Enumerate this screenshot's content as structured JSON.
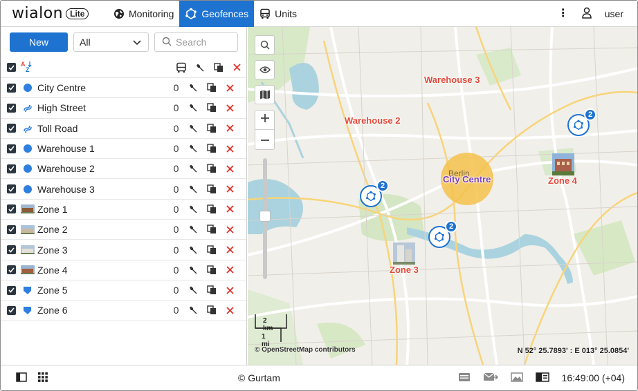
{
  "app": {
    "logo_text": "wialon",
    "logo_badge": "Lite"
  },
  "nav": {
    "tabs": [
      {
        "label": "Monitoring",
        "icon": "globe-icon",
        "active": false
      },
      {
        "label": "Geofences",
        "icon": "geofence-icon",
        "active": true
      },
      {
        "label": "Units",
        "icon": "bus-icon",
        "active": false
      }
    ],
    "user_label": "user"
  },
  "panel": {
    "new_button": "New",
    "filter_select": "All",
    "search_placeholder": "Search",
    "geofences": [
      {
        "name": "City Centre",
        "type": "circle",
        "count": "0"
      },
      {
        "name": "High Street",
        "type": "line",
        "count": "0"
      },
      {
        "name": "Toll Road",
        "type": "line",
        "count": "0"
      },
      {
        "name": "Warehouse 1",
        "type": "circle",
        "count": "0"
      },
      {
        "name": "Warehouse 2",
        "type": "circle",
        "count": "0"
      },
      {
        "name": "Warehouse 3",
        "type": "circle",
        "count": "0"
      },
      {
        "name": "Zone 1",
        "type": "photo",
        "count": "0"
      },
      {
        "name": "Zone 2",
        "type": "photo",
        "count": "0"
      },
      {
        "name": "Zone 3",
        "type": "photo",
        "count": "0"
      },
      {
        "name": "Zone 4",
        "type": "photo",
        "count": "0"
      },
      {
        "name": "Zone 5",
        "type": "polygon",
        "count": "0"
      },
      {
        "name": "Zone 6",
        "type": "polygon",
        "count": "0"
      }
    ]
  },
  "map": {
    "labels": {
      "warehouse3": "Warehouse 3",
      "warehouse2": "Warehouse 2",
      "city_centre": "City Centre",
      "zone4": "Zone 4",
      "zone3": "Zone 3",
      "berlin": "Berlin"
    },
    "unit_badges": [
      "2",
      "2",
      "2"
    ],
    "scale_km": "2 km",
    "scale_mi": "1 mi",
    "attribution": "© OpenStreetMap contributors",
    "coordinates": "N 52° 25.7893' : E 013° 25.0854'",
    "colors": {
      "geofence_label": "#e04a3a",
      "city_centre_fill": "#f5c14a",
      "accent": "#1e73d1"
    }
  },
  "footer": {
    "copyright": "© Gurtam",
    "clock": "16:49:00 (+04)"
  }
}
